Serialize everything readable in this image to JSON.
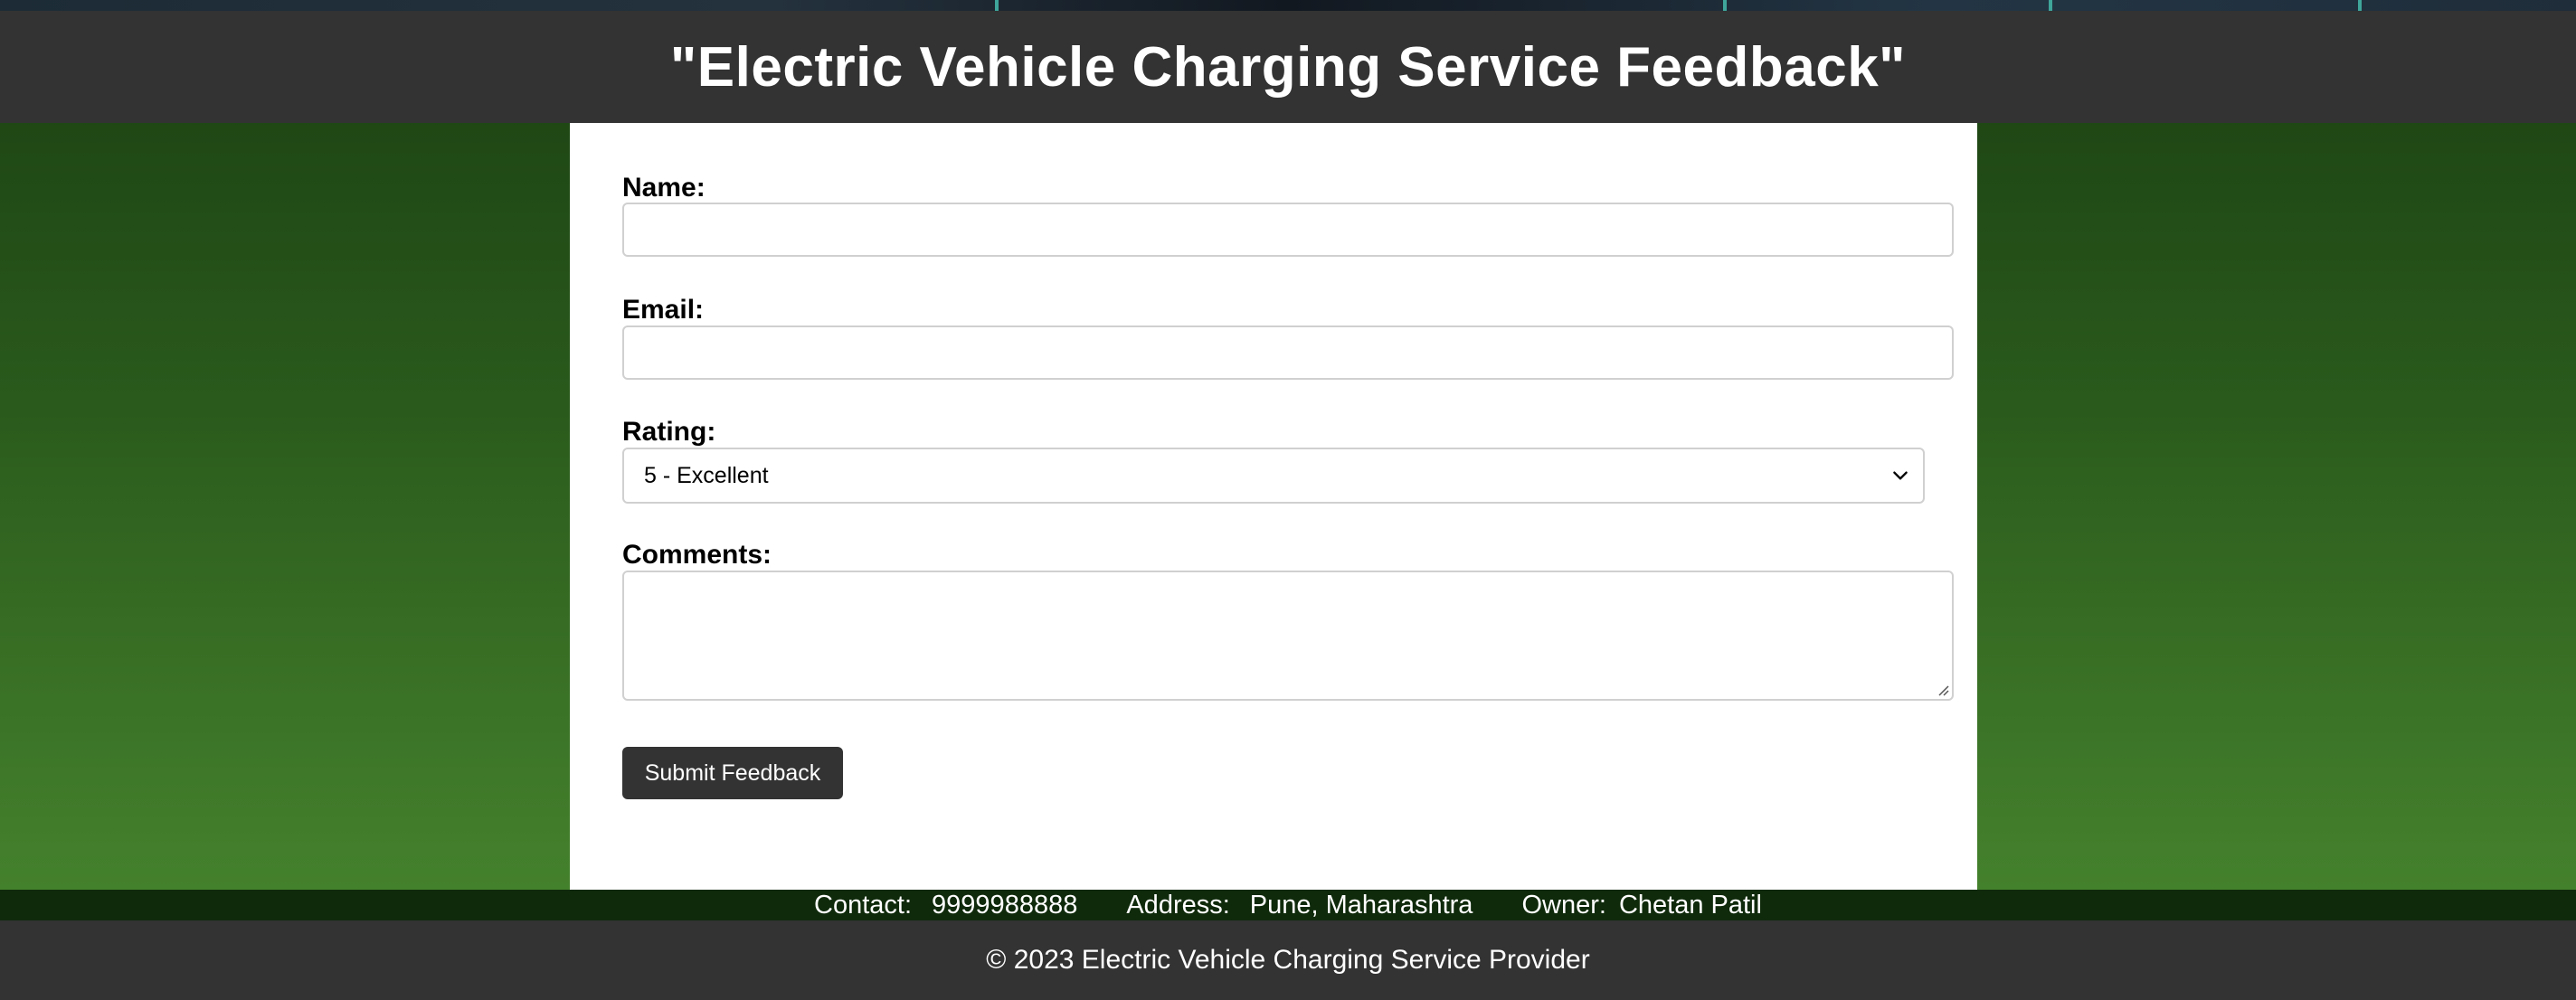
{
  "header": {
    "title": "\"Electric Vehicle Charging Service Feedback\""
  },
  "form": {
    "name_label": "Name:",
    "name_value": "",
    "email_label": "Email:",
    "email_value": "",
    "rating_label": "Rating:",
    "rating_selected": "5 - Excellent",
    "comments_label": "Comments:",
    "comments_value": "",
    "submit_label": "Submit Feedback"
  },
  "contact": {
    "contact_label": "Contact:",
    "contact_value": "9999988888",
    "address_label": "Address:",
    "address_value": "Pune, Maharashtra",
    "owner_label": "Owner:",
    "owner_value": "Chetan Patil"
  },
  "footer": {
    "copyright": "© 2023 Electric Vehicle Charging Service Provider"
  },
  "icons": {
    "select_arrow": "chevron-down-icon",
    "textarea_resize": "resize-grip-icon"
  },
  "colors": {
    "header_bg": "#333333",
    "footer_bg": "#333333",
    "contact_bar_bg": "#0f2a0b",
    "button_bg": "#333333",
    "page_gradient_top": "#1a3f12",
    "page_gradient_bottom": "#4a8a30"
  }
}
